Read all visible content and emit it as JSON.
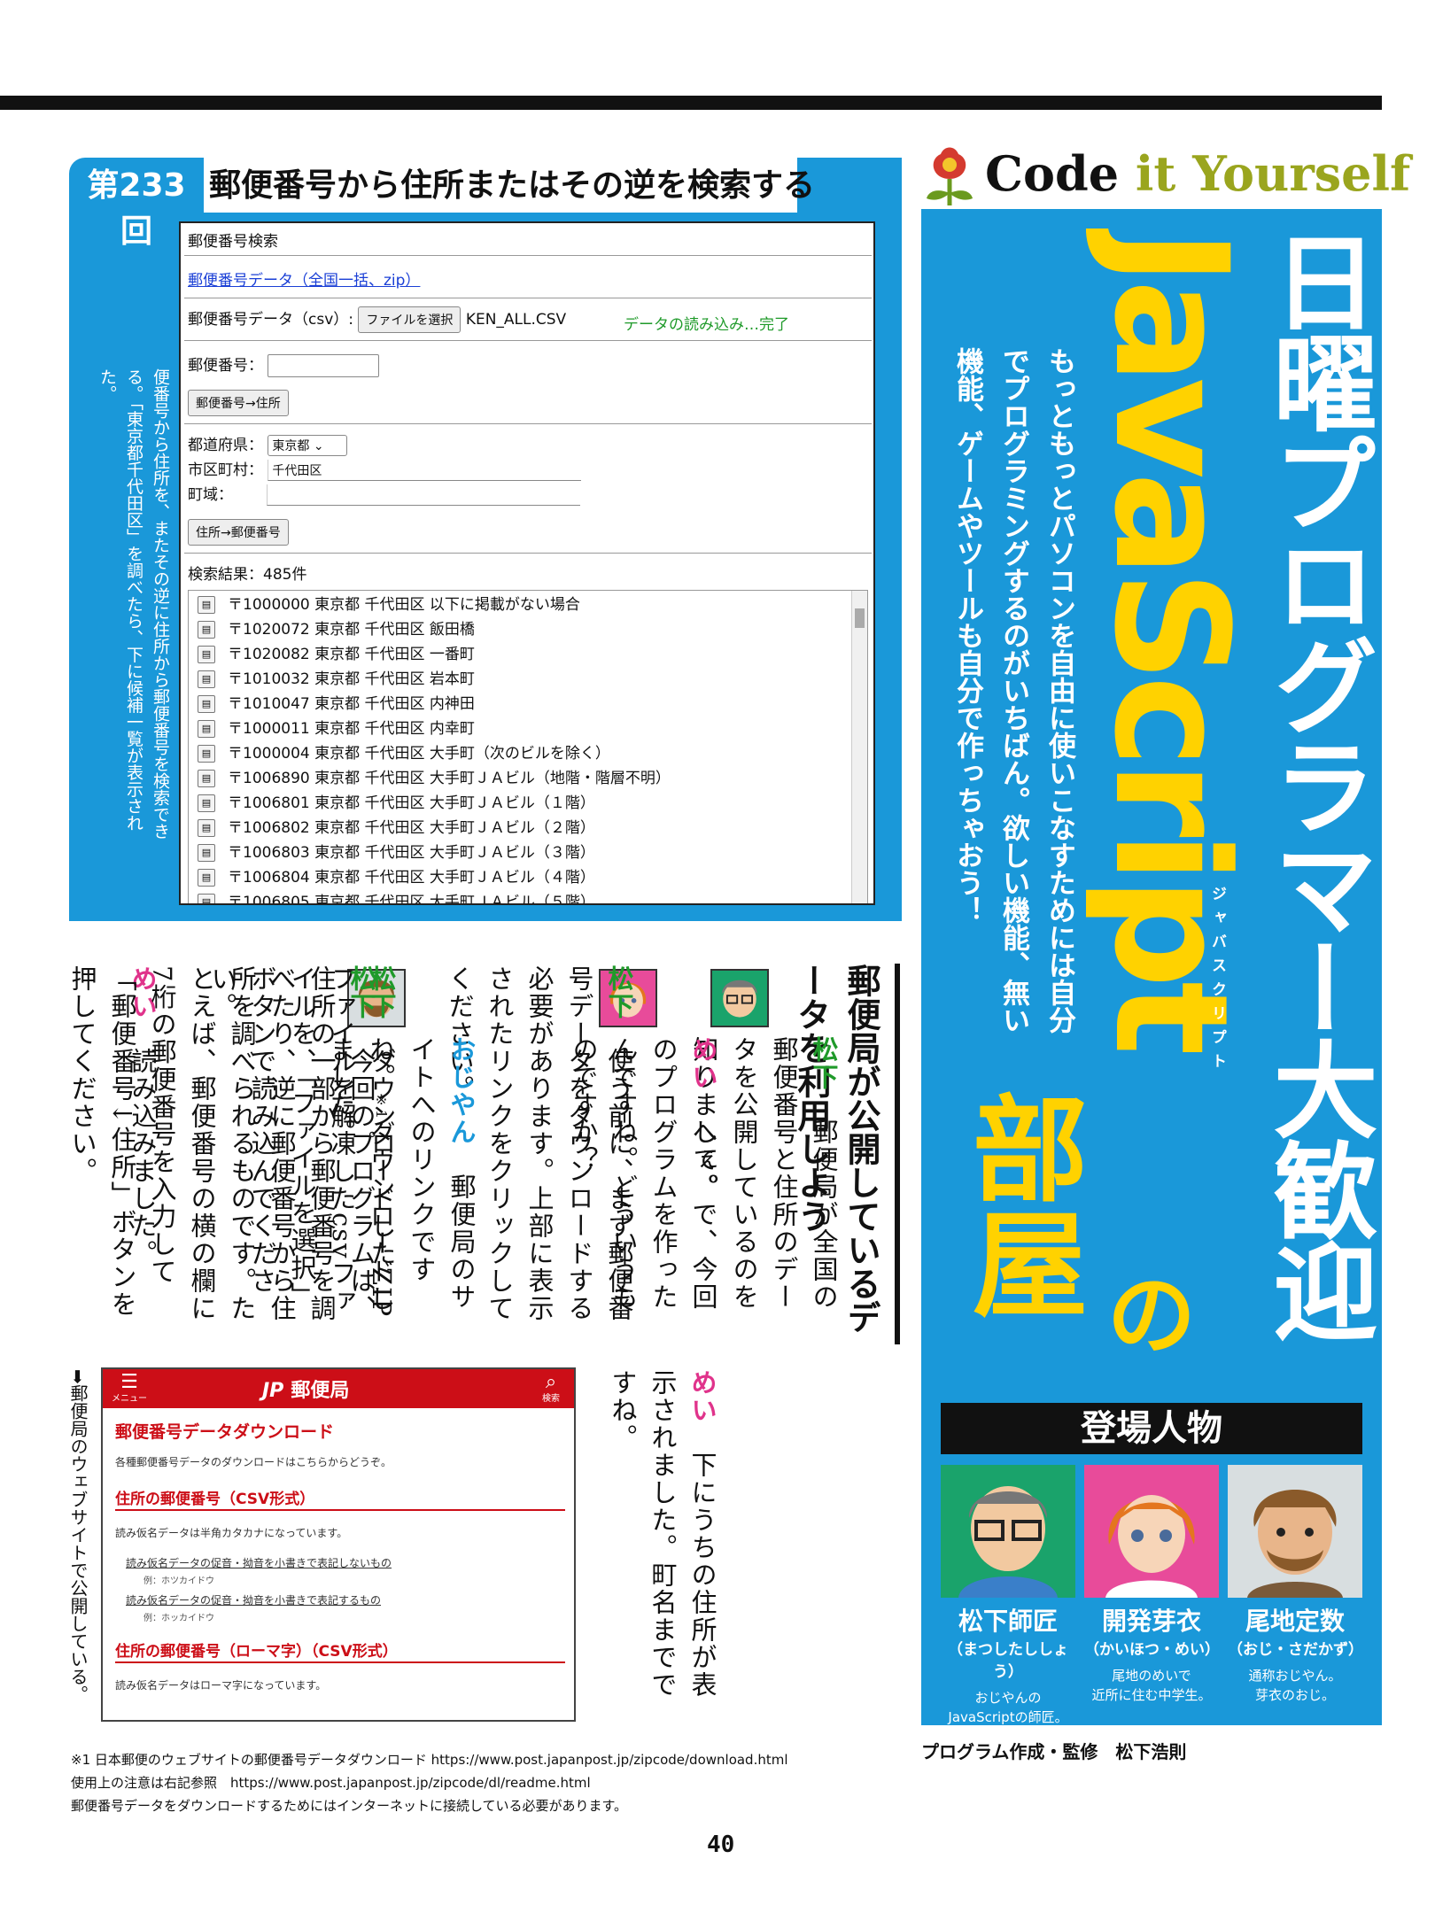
{
  "header": {
    "episode": "第233回",
    "title": "郵便番号から住所またはその逆を検索する"
  },
  "figure1_caption": "➡郵便局（日本郵便）が公開している郵便番号データを使い、郵便番号から住所を、またその逆に住所から郵便番号を検索できる。「東京都千代田区」を調べたら、下に候補一覧が表示された。",
  "app": {
    "heading": "郵便番号検索",
    "download_link": "郵便番号データ（全国一括、zip）",
    "csv_label": "郵便番号データ（csv）:",
    "file_button": "ファイルを選択",
    "file_name": "KEN_ALL.CSV",
    "load_status": "データの読み込み…完了",
    "zip_label": "郵便番号：",
    "zip_button": "郵便番号→住所",
    "pref_label": "都道府県：",
    "pref_value": "東京都",
    "city_label": "市区町村：",
    "city_value": "千代田区",
    "town_label": "町域：",
    "addr_button": "住所→郵便番号",
    "result_count": "検索結果：485件",
    "results": [
      "〒1000000 東京都 千代田区 以下に掲載がない場合",
      "〒1020072 東京都 千代田区 飯田橋",
      "〒1020082 東京都 千代田区 一番町",
      "〒1010032 東京都 千代田区 岩本町",
      "〒1010047 東京都 千代田区 内神田",
      "〒1000011 東京都 千代田区 内幸町",
      "〒1000004 東京都 千代田区 大手町（次のビルを除く）",
      "〒1006890 東京都 千代田区 大手町ＪＡビル（地階・階層不明）",
      "〒1006801 東京都 千代田区 大手町ＪＡビル（１階）",
      "〒1006802 東京都 千代田区 大手町ＪＡビル（２階）",
      "〒1006803 東京都 千代田区 大手町ＪＡビル（３階）",
      "〒1006804 東京都 千代田区 大手町ＪＡビル（４階）",
      "〒1006805 東京都 千代田区 大手町ＪＡビル（５階）"
    ]
  },
  "sidebar": {
    "logo_code": "Code ",
    "logo_it": "it ",
    "logo_yourself": "Yourself",
    "title_line1": "日曜プログラマー大歓迎",
    "title_js": "JavaScript",
    "title_ruby": "ジャバスクリプト",
    "title_no": "の",
    "title_room": "部屋",
    "tagline1": "もっともっとパソコンを自由に使いこなすためには自分",
    "tagline2": "でプログラミングするのがいちばん。欲しい機能、無い",
    "tagline3": "機能、ゲームやツールも自分で作っちゃおう！",
    "cast_title": "登場人物",
    "cast": [
      {
        "name": "松下師匠",
        "yomi": "（まつしたししょう）",
        "desc1": "おじやんの",
        "desc2": "JavaScriptの師匠。"
      },
      {
        "name": "開発芽衣",
        "yomi": "（かいほつ・めい）",
        "desc1": "尾地のめいで",
        "desc2": "近所に住む中学生。"
      },
      {
        "name": "尾地定数",
        "yomi": "（おじ・さだかず）",
        "desc1": "通称おじやん。",
        "desc2": "芽衣のおじ。"
      }
    ],
    "credit": "プログラム作成・監修　松下浩則"
  },
  "article": {
    "heading": "郵便局が公開しているデータを利用しよう",
    "s_mat": "松下",
    "s_mei": "めい",
    "s_oji": "おじやん",
    "p1": "郵便局が全国の郵便番号と住所のデータを公開しているのを知りまして。",
    "p2": "へぇ。で、今回のプログラムを作ったんですね。どういうものですか？",
    "p3": "使う前に、まず郵便番号データをダウンロードする必要があります。上部に表示されたリンクをクリックしてください。",
    "p4": "郵便局のサイトへのリンクですね。",
    "p4note": "※1",
    "p4b": "ダウンロードしました。",
    "p5": "ダウンロードしたZIPファイルを解凍したcsvファイルを、「ファイルを選択」ボタンで読み込んでください。",
    "p6": "読み込みました。",
    "p7": "今回のプログラムは、住所の一部から郵便番号を調べたり、逆に郵便番号から住所を調べられるものです。たとえば、郵便番号の横の欄に7桁の郵便番号を入力して「郵便番号↓住所」ボタンを押してください。",
    "p8": "下にうちの住所が表示されました。町名までですね。"
  },
  "figure2_caption": "➡郵便局のウェブサイトで公開している。",
  "post": {
    "menu": "メニュー",
    "brand_jp": "JP",
    "brand": "郵便局",
    "search": "検索",
    "h1": "郵便番号データダウンロード",
    "intro": "各種郵便番号データのダウンロードはこちらからどうぞ。",
    "h2": "住所の郵便番号（CSV形式）",
    "t2": "読み仮名データは半角カタカナになっています。",
    "l1": "読み仮名データの促音・拗音を小書きで表記しないもの",
    "e1": "例：ホツカイドウ",
    "l2": "読み仮名データの促音・拗音を小書きで表記するもの",
    "e2": "例：ホッカイドウ",
    "h3": "住所の郵便番号（ローマ字）（CSV形式）",
    "t3": "読み仮名データはローマ字になっています。"
  },
  "footnotes": {
    "n1": "※1 日本郵便のウェブサイトの郵便番号データダウンロード https://www.post.japanpost.jp/zipcode/download.html",
    "n2": "使用上の注意は右記参照　https://www.post.japanpost.jp/zipcode/dl/readme.html",
    "n3": "郵便番号データをダウンロードするためにはインターネットに接続している必要があります。"
  },
  "page_number": "40",
  "colors": {
    "accent_blue": "#1a98d9",
    "yellow": "#ffd200",
    "post_red": "#cc0e17",
    "green": "#1f9a2a",
    "pink": "#e0338b"
  }
}
